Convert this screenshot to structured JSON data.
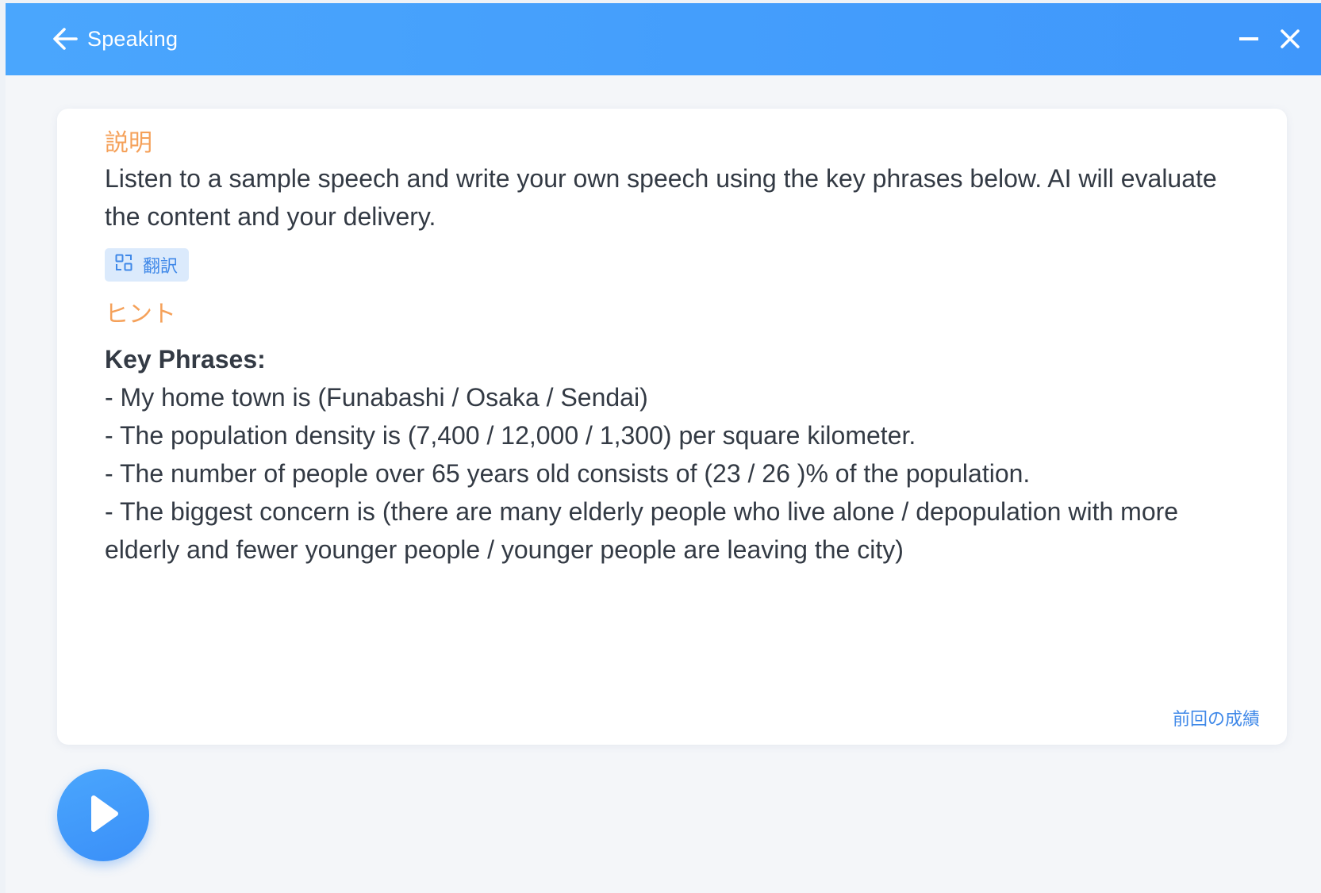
{
  "window": {
    "title": "Speaking"
  },
  "icons": {
    "back": "arrow-left-icon",
    "minimize": "minimize-icon",
    "close": "close-icon",
    "translate": "translate-icon",
    "play": "play-icon"
  },
  "colors": {
    "titlebar": "#4aa6fd",
    "section_label": "#f5a15a",
    "link": "#3f88e8",
    "translate_bg": "#dbeafc"
  },
  "card": {
    "description_label": "説明",
    "description_text": "Listen to a sample speech and write your own speech using the key phrases below. AI will evaluate the content and your delivery.",
    "translate_label": "翻訳",
    "hint_label": "ヒント",
    "hint_heading": "Key Phrases:",
    "hint_lines": [
      "- My home town is (Funabashi / Osaka / Sendai)",
      "- The population density is (7,400 / 12,000 / 1,300) per square kilometer.",
      "- The number of people over 65 years old consists of (23 / 26 )% of the population.",
      "- The biggest concern is (there are many elderly people who live alone / depopulation with more elderly and fewer younger people / younger people are leaving the city)"
    ],
    "previous_result_link": "前回の成績"
  }
}
